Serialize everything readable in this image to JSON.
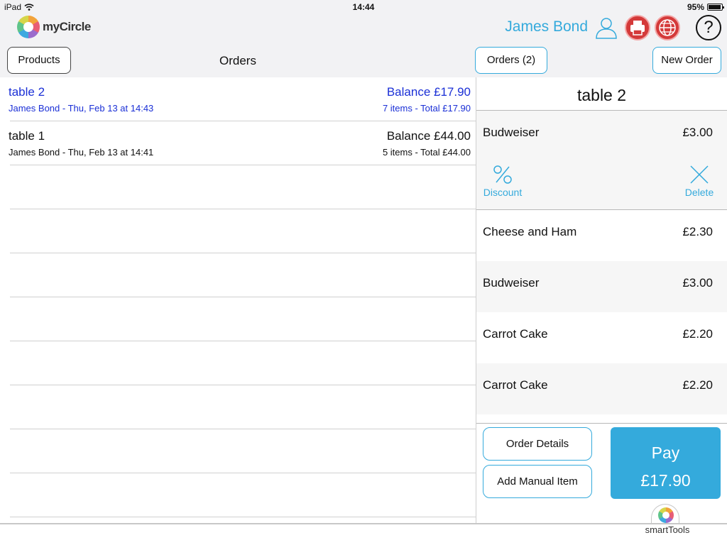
{
  "status": {
    "carrier": "iPad",
    "time": "14:44",
    "battery": "95%",
    "battery_level": 0.95
  },
  "header": {
    "app_name": "myCircle",
    "user_name": "James Bond",
    "help_label": "?"
  },
  "toolbar": {
    "products_label": "Products",
    "title": "Orders",
    "orders_count_label": "Orders (2)",
    "new_order_label": "New Order"
  },
  "orders": [
    {
      "name": "table 2",
      "meta": "James Bond - Thu, Feb 13 at 14:43",
      "balance": "Balance £17.90",
      "summary": "7 items - Total £17.90",
      "active": true
    },
    {
      "name": "table 1",
      "meta": "James Bond - Thu, Feb 13 at 14:41",
      "balance": "Balance £44.00",
      "summary": "5 items - Total £44.00",
      "active": false
    }
  ],
  "detail": {
    "title": "table 2",
    "items": [
      {
        "name": "Budweiser",
        "price": "£3.00"
      },
      {
        "name": "Cheese and Ham",
        "price": "£2.30"
      },
      {
        "name": "Budweiser",
        "price": "£3.00"
      },
      {
        "name": "Carrot Cake",
        "price": "£2.20"
      },
      {
        "name": "Carrot Cake",
        "price": "£2.20"
      }
    ],
    "actions": {
      "discount_label": "Discount",
      "delete_label": "Delete"
    },
    "buttons": {
      "order_details_label": "Order Details",
      "add_manual_item_label": "Add Manual Item",
      "pay_label": "Pay",
      "pay_amount": "£17.90"
    }
  },
  "footer": {
    "smarttools_label": "smartTools"
  },
  "colors": {
    "accent": "#34aadc",
    "active_order": "#1a2fd6",
    "alert_red": "#d43a3a"
  }
}
